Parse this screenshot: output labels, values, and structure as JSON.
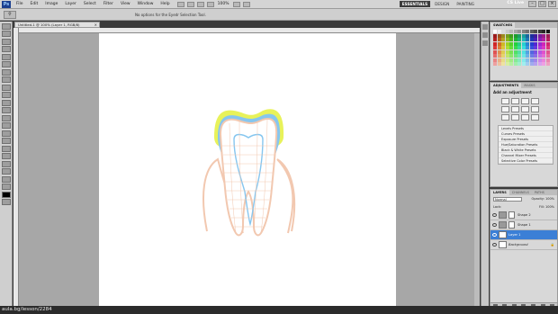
{
  "menubar": {
    "logo": "Ps",
    "items": [
      "File",
      "Edit",
      "Image",
      "Layer",
      "Select",
      "Filter",
      "View",
      "Window",
      "Help"
    ],
    "zoom": "100%",
    "workspaces": [
      "ESSENTIALS",
      "DESIGN",
      "PAINTING"
    ],
    "cslive": "CS Live"
  },
  "options": {
    "message": "No options for the Eyedr Selection Tool."
  },
  "document": {
    "tab_title": "Untitled-1 @ 100% (Layer 1, RGB/8)",
    "url": "aula.bg/lesson/2284"
  },
  "panels": {
    "swatches": {
      "tabs": [
        "SWATCHES"
      ]
    },
    "adjustments": {
      "tabs": [
        "ADJUSTMENTS",
        "MASKS"
      ],
      "title": "Add an adjustment",
      "presets": [
        "Levels Presets",
        "Curves Presets",
        "Exposure Presets",
        "Hue/Saturation Presets",
        "Black & White Presets",
        "Channel Mixer Presets",
        "Selective Color Presets"
      ]
    },
    "layers": {
      "tabs": [
        "LAYERS",
        "CHANNELS",
        "PATHS"
      ],
      "blend_mode": "Normal",
      "opacity_label": "Opacity:",
      "opacity_value": "100%",
      "lock_label": "Lock:",
      "fill_label": "Fill:",
      "fill_value": "100%",
      "items": [
        {
          "name": "Shape 2"
        },
        {
          "name": "Shape 1"
        },
        {
          "name": "Layer 1"
        },
        {
          "name": "Background"
        }
      ]
    }
  },
  "colors": {
    "tooth_outline": "#f2c8b0",
    "enamel_blue": "#86c6ef",
    "enamel_yellow": "#e8f25a",
    "selection_blue": "#3b7fd6"
  }
}
